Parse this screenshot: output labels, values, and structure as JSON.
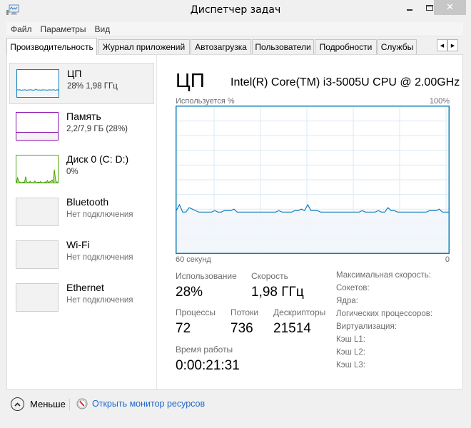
{
  "window": {
    "title": "Диспетчер задач",
    "close_glyph": "✕"
  },
  "menu": {
    "items": [
      {
        "label": "Файл"
      },
      {
        "label": "Параметры"
      },
      {
        "label": "Вид"
      }
    ]
  },
  "tabs": {
    "items": [
      {
        "label": "Производительность",
        "active": true
      },
      {
        "label": "Журнал приложений",
        "active": false
      },
      {
        "label": "Автозагрузка",
        "active": false
      },
      {
        "label": "Пользователи",
        "active": false
      },
      {
        "label": "Подробности",
        "active": false
      },
      {
        "label": "Службы",
        "active": false
      }
    ],
    "scroll_left": "◀",
    "scroll_right": "▶"
  },
  "sidebar": {
    "items": [
      {
        "name": "ЦП",
        "detail": "28%  1,98 ГГц",
        "color": "#117dbb",
        "fill": "#f1f6fa",
        "selected": true
      },
      {
        "name": "Память",
        "detail": "2,2/7,9 ГБ (28%)",
        "color": "#8b12ae",
        "fill": "#f4f2f4",
        "selected": false
      },
      {
        "name": "Диск 0 (C: D:)",
        "detail": "0%",
        "color": "#4da60c",
        "fill": "#eff7e9",
        "selected": false
      },
      {
        "name": "Bluetooth",
        "detail": "Нет подключения",
        "selected": false
      },
      {
        "name": "Wi-Fi",
        "detail": "Нет подключения",
        "selected": false
      },
      {
        "name": "Ethernet",
        "detail": "Нет подключения",
        "selected": false
      }
    ],
    "memory_usage_fraction": 0.28,
    "cpu_thumb_values": [
      27,
      26,
      27,
      25,
      26,
      26,
      27,
      25,
      26,
      26,
      27,
      26,
      25,
      26,
      29,
      26,
      26,
      26,
      25,
      27,
      26,
      26,
      26,
      25,
      27,
      26,
      26,
      27,
      26,
      25,
      27,
      26
    ],
    "disk_thumb_values": [
      0,
      18,
      5,
      2,
      0,
      0,
      2,
      0,
      22,
      3,
      0,
      0,
      5,
      0,
      0,
      0,
      6,
      0,
      0,
      2,
      0,
      4,
      0,
      0,
      0,
      3,
      0,
      8,
      0,
      3,
      5,
      10,
      2,
      48,
      12,
      0,
      3
    ]
  },
  "main": {
    "title": "ЦП",
    "cpu_model": "Intel(R) Core(TM) i3-5005U CPU @ 2.00GHz",
    "graph_label_left": "Используется %",
    "graph_label_right": "100%",
    "axis_left": "60 секунд",
    "axis_right": "0",
    "accent_color": "#117dbb",
    "grid_color": "#d9eaf4",
    "fill_color": "#f1f6fa"
  },
  "chart_data": {
    "type": "area",
    "title": "Используется %",
    "xlabel_left": "60 секунд",
    "xlabel_right": "0",
    "ylim": [
      0,
      100
    ],
    "ylabel_max": "100%",
    "grid": true,
    "grid_rows": 10,
    "grid_cols": 20,
    "values": [
      29,
      33,
      28,
      28,
      31,
      30,
      29,
      28,
      28,
      28,
      28,
      28,
      29,
      28,
      28,
      29,
      29,
      29,
      30,
      28,
      28,
      28,
      28,
      28,
      28,
      28,
      28,
      28,
      28,
      28,
      28,
      28,
      29,
      28,
      28,
      28,
      28,
      29,
      29,
      30,
      29,
      33,
      29,
      29,
      29,
      28,
      28,
      28,
      28,
      28,
      28,
      28,
      28,
      28,
      28,
      28,
      28,
      28,
      29,
      28,
      28,
      28,
      28,
      29,
      28,
      28,
      31,
      29,
      29,
      28,
      28,
      28,
      28,
      28,
      28,
      28,
      28,
      28,
      28,
      29,
      29,
      29,
      30,
      28,
      28,
      28
    ]
  },
  "stats": {
    "usage": {
      "label": "Использование",
      "value": "28%"
    },
    "speed": {
      "label": "Скорость",
      "value": "1,98 ГГц"
    },
    "processes": {
      "label": "Процессы",
      "value": "72"
    },
    "threads": {
      "label": "Потоки",
      "value": "736"
    },
    "handles": {
      "label": "Дескрипторы",
      "value": "21514"
    },
    "uptime": {
      "label": "Время работы",
      "value": "0:00:21:31"
    }
  },
  "specs": [
    {
      "label": "Максимальная скорость:"
    },
    {
      "label": "Сокетов:"
    },
    {
      "label": "Ядра:"
    },
    {
      "label": "Логических процессоров:"
    },
    {
      "label": "Виртуализация:"
    },
    {
      "label": "Кэш L1:"
    },
    {
      "label": "Кэш L2:"
    },
    {
      "label": "Кэш L3:"
    }
  ],
  "footer": {
    "less_label": "Меньше",
    "resource_monitor_label": "Открыть монитор ресурсов"
  }
}
